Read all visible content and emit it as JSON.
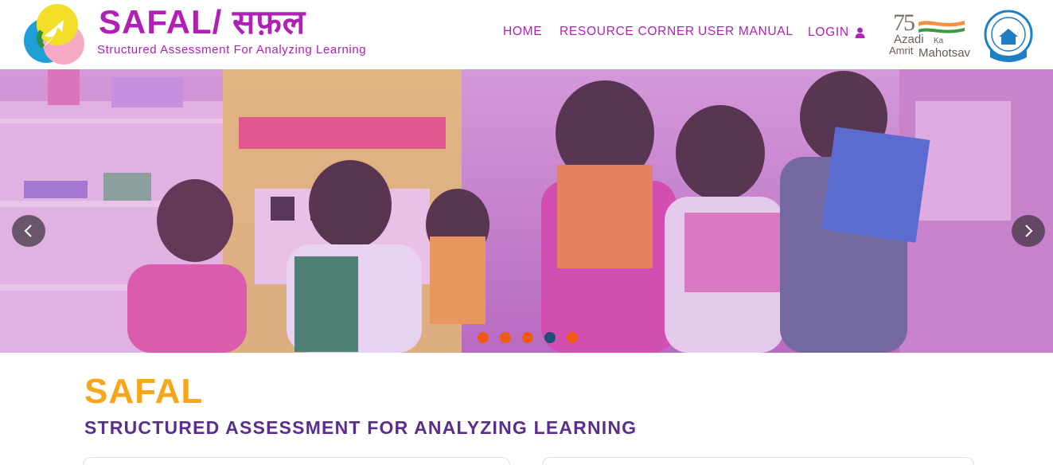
{
  "header": {
    "brand_title": "SAFAL/ सफ़ल",
    "brand_subtitle": "Structured Assessment For Analyzing Learning",
    "nav": [
      {
        "label": "HOME",
        "icon": null
      },
      {
        "label": "RESOURCE CORNER",
        "icon": null
      },
      {
        "label": "USER MANUAL",
        "icon": null
      },
      {
        "label": "LOGIN",
        "icon": "user-icon"
      }
    ],
    "azadi_logo": {
      "number": "75",
      "line1": "Azadi",
      "line2": "Ka",
      "line3": "Amrit",
      "line4": "Mahotsav"
    },
    "cbse_logo_icon": "cbse-emblem-icon"
  },
  "carousel": {
    "prev_icon": "chevron-left-icon",
    "next_icon": "chevron-right-icon",
    "slide_count": 5,
    "active_slide_index": 3,
    "dot_color": "#f05a12",
    "active_dot_color": "#1f4e7a"
  },
  "main": {
    "title": "SAFAL",
    "subtitle": "STRUCTURED ASSESSMENT FOR ANALYZING LEARNING"
  },
  "colors": {
    "brand_purple": "#b01fb6",
    "title_orange": "#f7a61a",
    "subtitle_purple": "#5a2d8e"
  }
}
